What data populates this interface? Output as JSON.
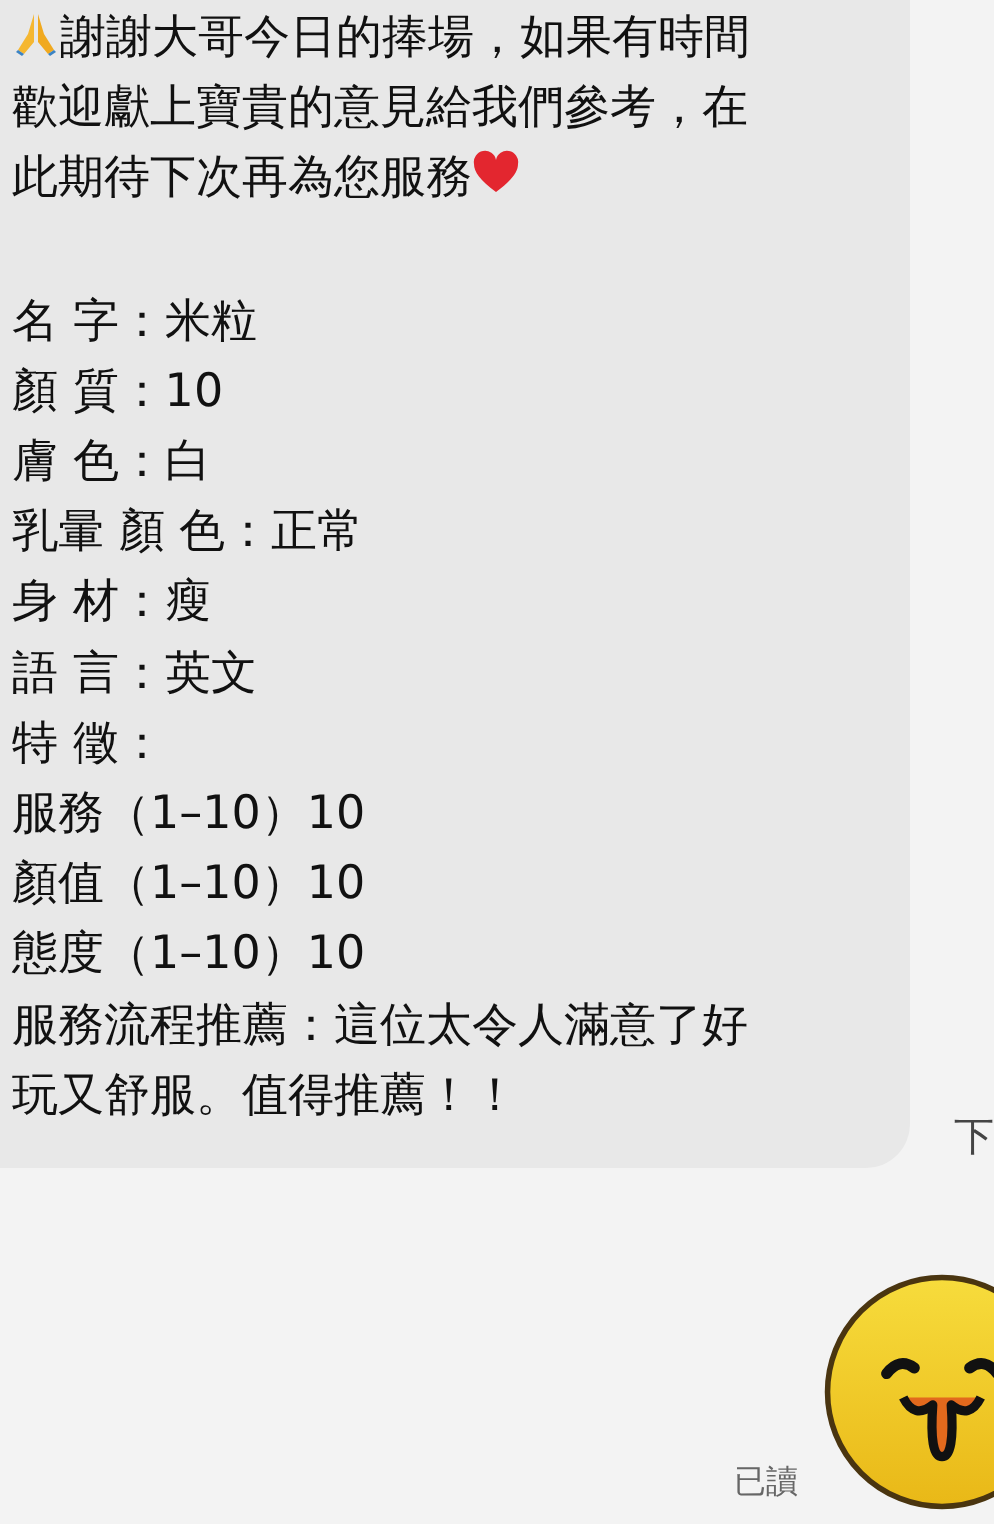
{
  "message": {
    "intro_lines": [
      "謝謝大哥今日的捧場，如果有時間",
      "歡迎獻上寶貴的意見給我們參考，在",
      "此期待下次再為您服務"
    ],
    "details": [
      "名 字：米粒",
      "顏 質：10",
      "膚 色：白",
      "乳暈 顏 色：正常",
      "身 材：瘦",
      "語 言：英文",
      "特 徵：",
      "服務（1–10）10",
      "顏值（1–10）10",
      "態度（1–10）10"
    ],
    "closing_lines": [
      "服務流程推薦：這位太令人滿意了好",
      "玩又舒服。值得推薦！！"
    ]
  },
  "time": "下",
  "read_status": "已讀"
}
